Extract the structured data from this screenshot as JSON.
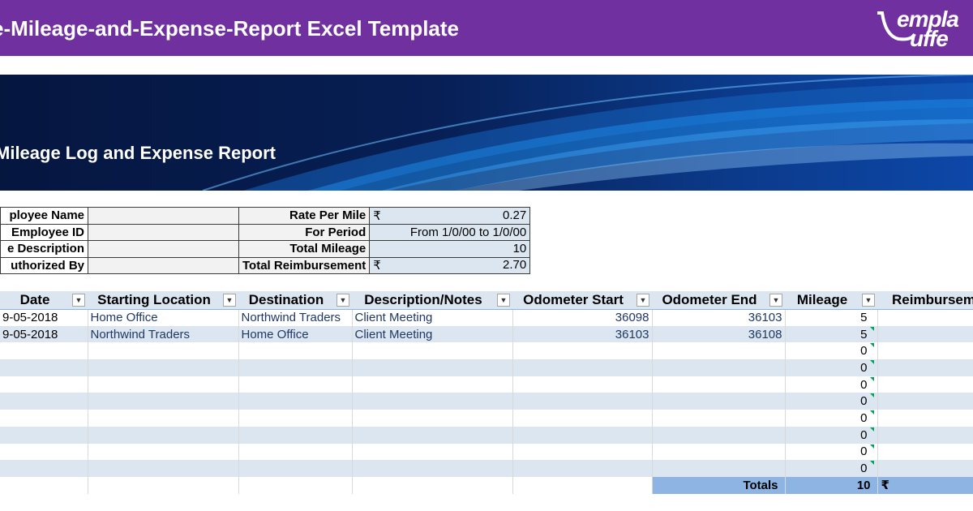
{
  "header": {
    "title": "e-Mileage-and-Expense-Report Excel Template",
    "logo_line1": "empla",
    "logo_line2": "uffe"
  },
  "banner": {
    "title": "Mileage Log and Expense Report"
  },
  "info": {
    "rows": [
      {
        "label": "ployee Name",
        "label2": "Rate Per Mile",
        "symbol": "₹",
        "value": "0.27"
      },
      {
        "label": "Employee ID",
        "label2": "For Period",
        "symbol": "",
        "value": "From 1/0/00 to 1/0/00"
      },
      {
        "label": "e Description",
        "label2": "Total Mileage",
        "symbol": "",
        "value": "10"
      },
      {
        "label": "uthorized By",
        "label2": "Total Reimbursement",
        "symbol": "₹",
        "value": "2.70"
      }
    ]
  },
  "log": {
    "columns": [
      "Date",
      "Starting Location",
      "Destination",
      "Description/Notes",
      "Odometer Start",
      "Odometer End",
      "Mileage",
      "Reimbursem"
    ],
    "rows": [
      {
        "date": "9-05-2018",
        "start": "Home Office",
        "dest": "Northwind Traders",
        "desc": "Client Meeting",
        "odo_start": "36098",
        "odo_end": "36103",
        "mileage": "5"
      },
      {
        "date": "9-05-2018",
        "start": "Northwind Traders",
        "dest": "Home Office",
        "desc": "Client Meeting",
        "odo_start": "36103",
        "odo_end": "36108",
        "mileage": "5"
      },
      {
        "date": "",
        "start": "",
        "dest": "",
        "desc": "",
        "odo_start": "",
        "odo_end": "",
        "mileage": "0"
      },
      {
        "date": "",
        "start": "",
        "dest": "",
        "desc": "",
        "odo_start": "",
        "odo_end": "",
        "mileage": "0"
      },
      {
        "date": "",
        "start": "",
        "dest": "",
        "desc": "",
        "odo_start": "",
        "odo_end": "",
        "mileage": "0"
      },
      {
        "date": "",
        "start": "",
        "dest": "",
        "desc": "",
        "odo_start": "",
        "odo_end": "",
        "mileage": "0"
      },
      {
        "date": "",
        "start": "",
        "dest": "",
        "desc": "",
        "odo_start": "",
        "odo_end": "",
        "mileage": "0"
      },
      {
        "date": "",
        "start": "",
        "dest": "",
        "desc": "",
        "odo_start": "",
        "odo_end": "",
        "mileage": "0"
      },
      {
        "date": "",
        "start": "",
        "dest": "",
        "desc": "",
        "odo_start": "",
        "odo_end": "",
        "mileage": "0"
      },
      {
        "date": "",
        "start": "",
        "dest": "",
        "desc": "",
        "odo_start": "",
        "odo_end": "",
        "mileage": "0"
      }
    ],
    "totals_label": "Totals",
    "totals_mileage": "10",
    "totals_symbol": "₹"
  },
  "colors": {
    "header_bg": "#7030a0",
    "banner_dark": "#05163f",
    "table_band": "#dce6f1",
    "total_band": "#8db4e2"
  }
}
